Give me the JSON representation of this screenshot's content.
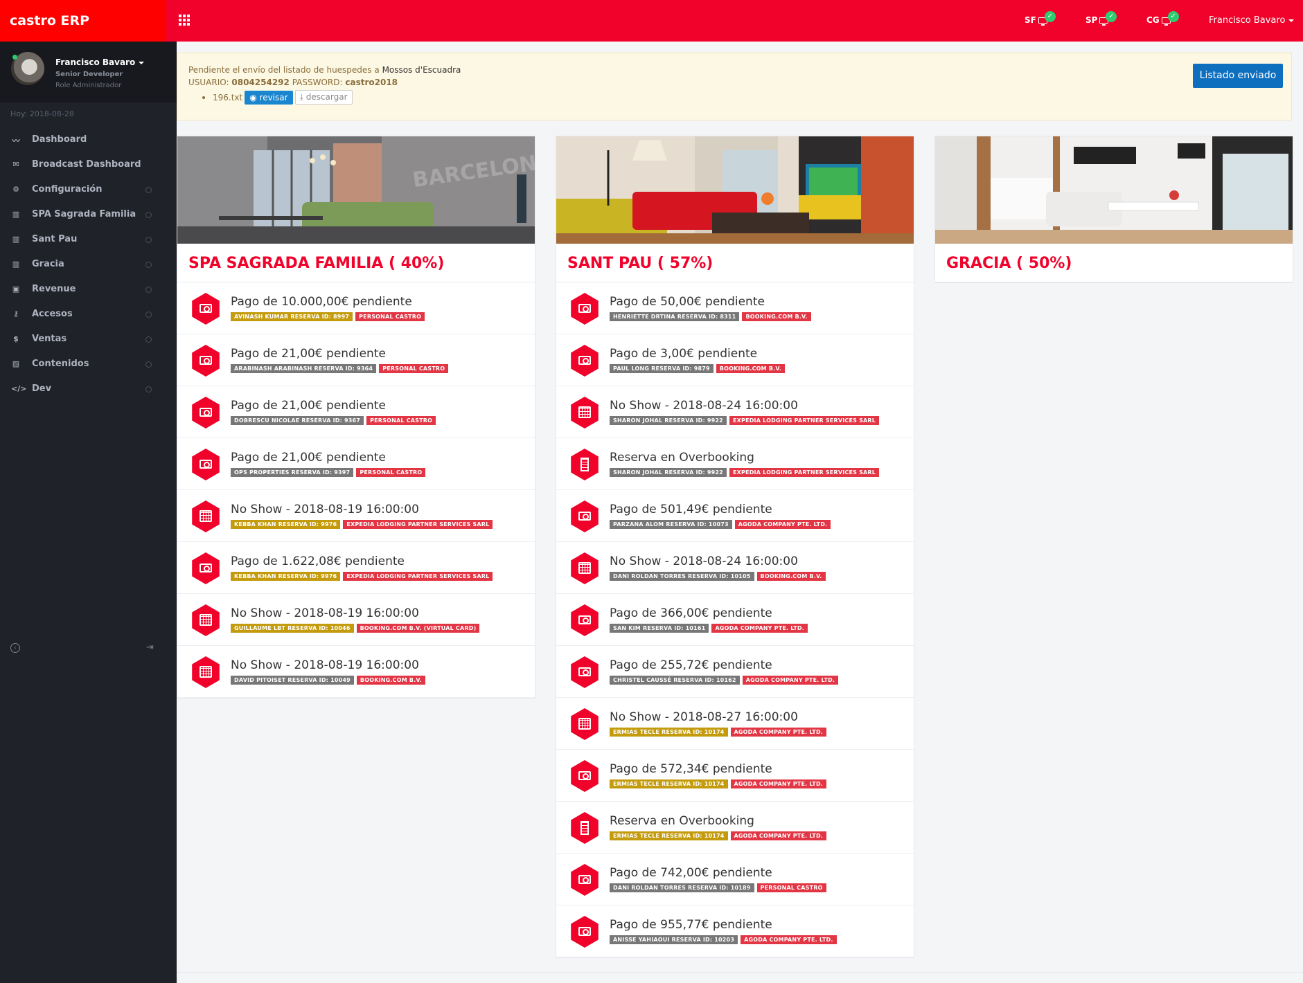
{
  "brand": "castro ERP",
  "topbar": {
    "sites": [
      {
        "code": "SF",
        "status": "ok"
      },
      {
        "code": "SP",
        "status": "ok"
      },
      {
        "code": "CG",
        "status": "ok"
      }
    ],
    "user": "Francisco Bavaro"
  },
  "sidebar": {
    "profile": {
      "name": "Francisco Bavaro",
      "title": "Senior Developer",
      "role": "Role Administrador"
    },
    "today": "Hoy: 2018-08-28",
    "items": [
      {
        "label": "Dashboard",
        "icon": "chart-line-icon"
      },
      {
        "label": "Broadcast Dashboard",
        "icon": "envelope-icon"
      },
      {
        "label": "Configuración",
        "icon": "gear-icon"
      },
      {
        "label": "SPA Sagrada Familia",
        "icon": "building-icon"
      },
      {
        "label": "Sant Pau",
        "icon": "building-icon"
      },
      {
        "label": "Gracia",
        "icon": "building-icon"
      },
      {
        "label": "Revenue",
        "icon": "money-icon"
      },
      {
        "label": "Accesos",
        "icon": "key-icon"
      },
      {
        "label": "Ventas",
        "icon": "dollar-icon"
      },
      {
        "label": "Contenidos",
        "icon": "image-icon"
      },
      {
        "label": "Dev",
        "icon": "code-icon"
      }
    ]
  },
  "alert": {
    "line1_prefix": "Pendiente el envío del listado de huespedes a",
    "line1_target": "Mossos d'Escuadra",
    "user_label": "USUARIO:",
    "user_value": "0804254292",
    "pass_label": "PASSWORD:",
    "pass_value": "castro2018",
    "file": "196.txt",
    "review_btn": "revisar",
    "download_btn": "descargar",
    "sent_btn": "Listado enviado"
  },
  "cards": [
    {
      "title": "SPA SAGRADA FAMILIA ( 40%)",
      "items": [
        {
          "icon": "money",
          "text": "Pago de 10.000,00€ pendiente",
          "guest": "AVINASH KUMAR RESERVA ID: 8997",
          "guest_color": "yellow",
          "channel": "PERSONAL CASTRO"
        },
        {
          "icon": "money",
          "text": "Pago de 21,00€ pendiente",
          "guest": "ARABINASH ARABINASH RESERVA ID: 9364",
          "guest_color": "gray",
          "channel": "PERSONAL CASTRO"
        },
        {
          "icon": "money",
          "text": "Pago de 21,00€ pendiente",
          "guest": "DOBRESCU NICOLAE RESERVA ID: 9367",
          "guest_color": "gray",
          "channel": "PERSONAL CASTRO"
        },
        {
          "icon": "money",
          "text": "Pago de 21,00€ pendiente",
          "guest": "OPS PROPERTIES RESERVA ID: 9397",
          "guest_color": "gray",
          "channel": "PERSONAL CASTRO"
        },
        {
          "icon": "calendar",
          "text": "No Show - 2018-08-19 16:00:00",
          "guest": "KEBBA KHAN RESERVA ID: 9976",
          "guest_color": "yellow",
          "channel": "EXPEDIA LODGING PARTNER SERVICES SARL"
        },
        {
          "icon": "money",
          "text": "Pago de 1.622,08€ pendiente",
          "guest": "KEBBA KHAN RESERVA ID: 9976",
          "guest_color": "yellow",
          "channel": "EXPEDIA LODGING PARTNER SERVICES SARL"
        },
        {
          "icon": "calendar",
          "text": "No Show - 2018-08-19 16:00:00",
          "guest": "GUILLAUME LBT RESERVA ID: 10046",
          "guest_color": "yellow",
          "channel": "BOOKING.COM B.V. (VIRTUAL CARD)"
        },
        {
          "icon": "calendar",
          "text": "No Show - 2018-08-19 16:00:00",
          "guest": "DAVID PITOISET RESERVA ID: 10049",
          "guest_color": "gray",
          "channel": "BOOKING.COM B.V."
        }
      ]
    },
    {
      "title": "SANT PAU ( 57%)",
      "items": [
        {
          "icon": "money",
          "text": "Pago de 50,00€ pendiente",
          "guest": "HENRIETTE DRTINA RESERVA ID: 8311",
          "guest_color": "gray",
          "channel": "BOOKING.COM B.V."
        },
        {
          "icon": "money",
          "text": "Pago de 3,00€ pendiente",
          "guest": "PAUL LONG RESERVA ID: 9879",
          "guest_color": "gray",
          "channel": "BOOKING.COM B.V."
        },
        {
          "icon": "calendar",
          "text": "No Show - 2018-08-24 16:00:00",
          "guest": "SHARON JOHAL RESERVA ID: 9922",
          "guest_color": "gray",
          "channel": "EXPEDIA LODGING PARTNER SERVICES SARL"
        },
        {
          "icon": "building",
          "text": "Reserva en Overbooking",
          "guest": "SHARON JOHAL RESERVA ID: 9922",
          "guest_color": "gray",
          "channel": "EXPEDIA LODGING PARTNER SERVICES SARL"
        },
        {
          "icon": "money",
          "text": "Pago de 501,49€ pendiente",
          "guest": "PARZANA ALOM RESERVA ID: 10073",
          "guest_color": "gray",
          "channel": "AGODA COMPANY PTE. LTD."
        },
        {
          "icon": "calendar",
          "text": "No Show - 2018-08-24 16:00:00",
          "guest": "DANI ROLDAN TORRES RESERVA ID: 10105",
          "guest_color": "gray",
          "channel": "BOOKING.COM B.V."
        },
        {
          "icon": "money",
          "text": "Pago de 366,00€ pendiente",
          "guest": "SAN KIM RESERVA ID: 10161",
          "guest_color": "gray",
          "channel": "AGODA COMPANY PTE. LTD."
        },
        {
          "icon": "money",
          "text": "Pago de 255,72€ pendiente",
          "guest": "CHRISTEL CAUSSÉ RESERVA ID: 10162",
          "guest_color": "gray",
          "channel": "AGODA COMPANY PTE. LTD."
        },
        {
          "icon": "calendar",
          "text": "No Show - 2018-08-27 16:00:00",
          "guest": "ERMIAS TECLE RESERVA ID: 10174",
          "guest_color": "yellow",
          "channel": "AGODA COMPANY PTE. LTD."
        },
        {
          "icon": "money",
          "text": "Pago de 572,34€ pendiente",
          "guest": "ERMIAS TECLE RESERVA ID: 10174",
          "guest_color": "yellow",
          "channel": "AGODA COMPANY PTE. LTD."
        },
        {
          "icon": "building",
          "text": "Reserva en Overbooking",
          "guest": "ERMIAS TECLE RESERVA ID: 10174",
          "guest_color": "yellow",
          "channel": "AGODA COMPANY PTE. LTD."
        },
        {
          "icon": "money",
          "text": "Pago de 742,00€ pendiente",
          "guest": "DANI ROLDAN TORRES RESERVA ID: 10189",
          "guest_color": "gray",
          "channel": "PERSONAL CASTRO"
        },
        {
          "icon": "money",
          "text": "Pago de 955,77€ pendiente",
          "guest": "ANISSE YAHIAOUI RESERVA ID: 10203",
          "guest_color": "gray",
          "channel": "AGODA COMPANY PTE. LTD."
        }
      ]
    },
    {
      "title": "GRACIA ( 50%)",
      "items": []
    }
  ],
  "colors": {
    "topbar": "#f0022a",
    "brand_bg": "#ff0000",
    "sidebar": "#1f2228",
    "accent": "#f0022a",
    "ok": "#2ecc71",
    "primary": "#0f6fbf"
  }
}
